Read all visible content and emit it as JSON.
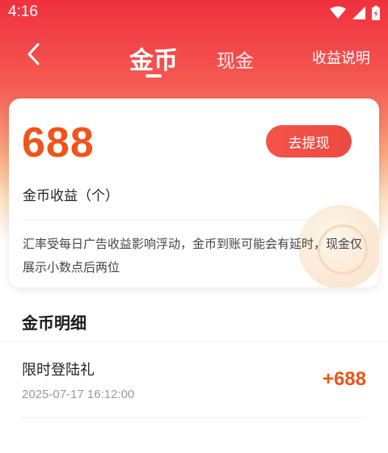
{
  "status_bar": {
    "time": "4:16"
  },
  "header": {
    "tabs": [
      {
        "label": "金币",
        "active": true
      },
      {
        "label": "现金",
        "active": false
      }
    ],
    "explain_label": "收益说明"
  },
  "summary": {
    "coin_amount": "688",
    "withdraw_label": "去提现",
    "coin_label": "金币收益（个）",
    "notice": "汇率受每日广告收益影响浮动，金币到账可能会有延时，现金仅展示小数点后两位"
  },
  "details": {
    "title": "金币明细",
    "records": [
      {
        "name": "限时登陆礼",
        "time": "2025-07-17 16:12:00",
        "amount": "+688"
      }
    ]
  },
  "colors": {
    "brand_red": "#f0303e",
    "amount_orange": "#f0541c",
    "button_red": "#ec4a40"
  }
}
